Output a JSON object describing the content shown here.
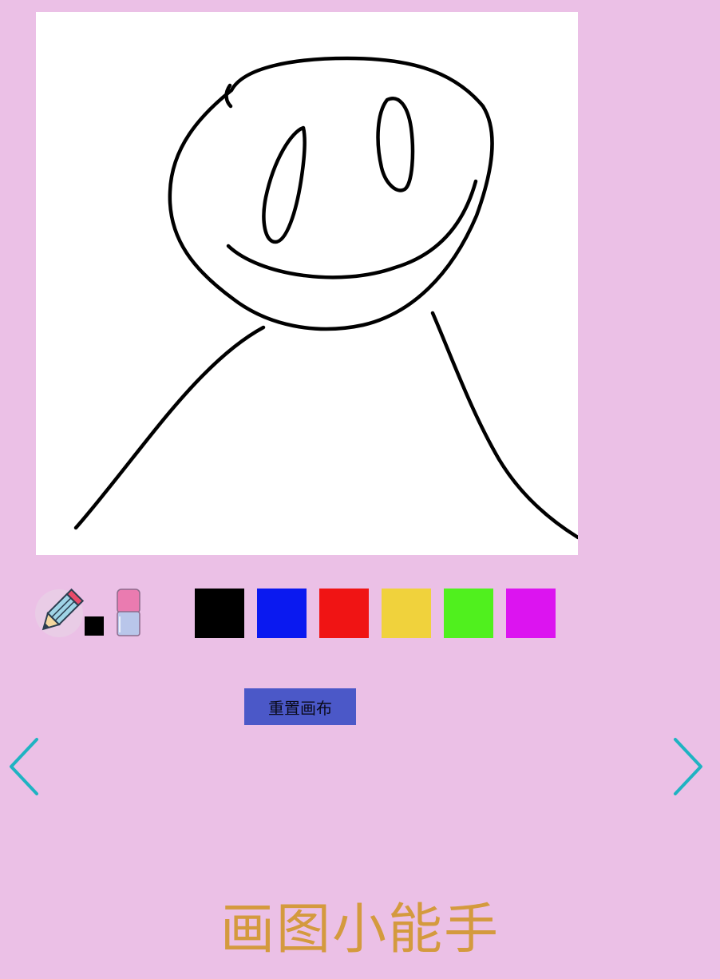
{
  "canvas": {
    "background": "#ffffff",
    "stroke_color": "#000000"
  },
  "toolbar": {
    "pencil_icon": "pencil-icon",
    "eraser_icon": "eraser-icon",
    "current_color": "#000000",
    "palette": [
      {
        "name": "black",
        "color": "#000000"
      },
      {
        "name": "blue",
        "color": "#0a19f0"
      },
      {
        "name": "red",
        "color": "#f01414"
      },
      {
        "name": "yellow",
        "color": "#f0d23c"
      },
      {
        "name": "green",
        "color": "#50f01e"
      },
      {
        "name": "magenta",
        "color": "#dc14f0"
      }
    ]
  },
  "reset_button": {
    "label": "重置画布",
    "color": "#4b58c8"
  },
  "nav": {
    "prev_icon": "chevron-left-icon",
    "next_icon": "chevron-right-icon",
    "color": "#1fb3c2"
  },
  "page_title": "画图小能手",
  "colors": {
    "background": "#ebc0e6",
    "title": "#d49a3e"
  }
}
